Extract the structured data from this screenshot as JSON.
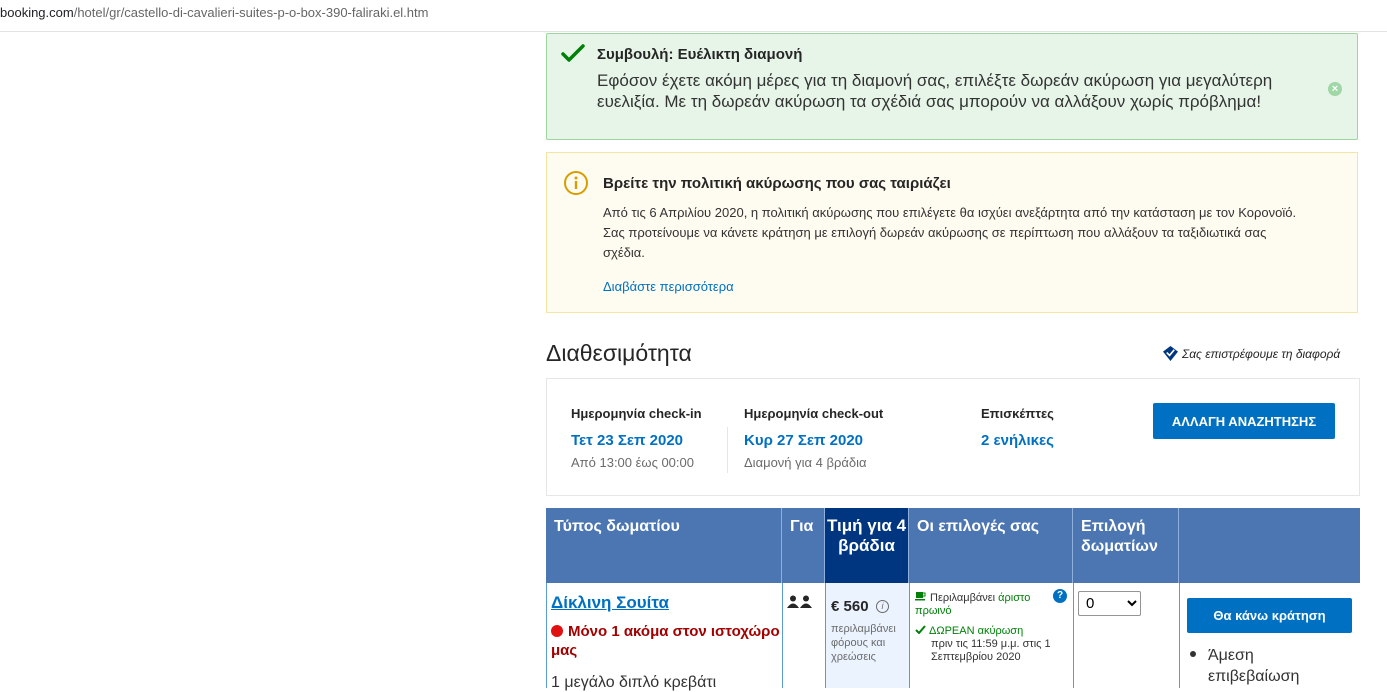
{
  "browser": {
    "url_domain": "booking.com",
    "url_path": "/hotel/gr/castello-di-cavalieri-suites-p-o-box-390-faliraki.el.htm"
  },
  "tip": {
    "title": "Συμβουλή: Ευέλικτη διαμονή",
    "body": "Εφόσον έχετε ακόμη μέρες για τη διαμονή σας, επιλέξτε δωρεάν ακύρωση για μεγαλύτερη ευελιξία. Με τη δωρεάν ακύρωση τα σχέδιά σας μπορούν να αλλάξουν χωρίς πρόβλημα!",
    "close_symbol": "×"
  },
  "policy": {
    "title": "Βρείτε την πολιτική ακύρωσης που σας ταιριάζει",
    "body": "Από τις 6 Απριλίου 2020, η πολιτική ακύρωσης που επιλέγετε θα ισχύει ανεξάρτητα από την κατάσταση με τον Κορονοϊό. Σας προτείνουμε να κάνετε κράτηση με επιλογή δωρεάν ακύρωσης σε περίπτωση που αλλάξουν τα ταξιδιωτικά σας σχέδια.",
    "read_more": "Διαβάστε περισσότερα"
  },
  "availability": {
    "title": "Διαθεσιμότητα",
    "price_match": "Σας επιστρέφουμε τη διαφορά"
  },
  "search": {
    "checkin_label": "Ημερομηνία check-in",
    "checkin_value": "Τετ 23 Σεπ 2020",
    "checkin_sub": "Από 13:00 έως 00:00",
    "checkout_label": "Ημερομηνία check-out",
    "checkout_value": "Κυρ 27 Σεπ 2020",
    "checkout_sub": "Διαμονή για 4 βράδια",
    "guests_label": "Επισκέπτες",
    "guests_value": "2 ενήλικες",
    "change_button": "ΑΛΛΑΓΗ ΑΝΑΖΗΤΗΣΗΣ"
  },
  "table": {
    "headers": {
      "room_type": "Τύπος δωματίου",
      "for": "Για",
      "price": "Τιμή για 4 βράδια",
      "options": "Οι επιλογές σας",
      "select": "Επιλογή δωματίων"
    },
    "row": {
      "room_name": "Δίκλινη Σουίτα",
      "scarcity": "Μόνο 1 ακόμα στον ιστοχώρο μας",
      "beds": "1 μεγάλο διπλό κρεβάτι",
      "price": "€ 560",
      "price_note": "περιλαμβάνει φόρους και χρεώσεις",
      "breakfast_prefix": "Περιλαμβάνει ",
      "breakfast_highlight": "άριστο πρωινό",
      "free_cancel": "ΔΩΡΕΑΝ ακύρωση",
      "free_cancel_detail": "πριν τις 11:59 μ.μ. στις 1 Σεπτεμβρίου 2020",
      "select_value": "0",
      "book_button": "Θα κάνω κράτηση",
      "confirm_line1": "Άμεση",
      "confirm_line2": "επιβεβαίωση"
    }
  },
  "colors": {
    "primary": "#0071c2",
    "header_blue": "#4c76b2",
    "dark_blue": "#003580",
    "green": "#008009",
    "red": "#a30000"
  }
}
